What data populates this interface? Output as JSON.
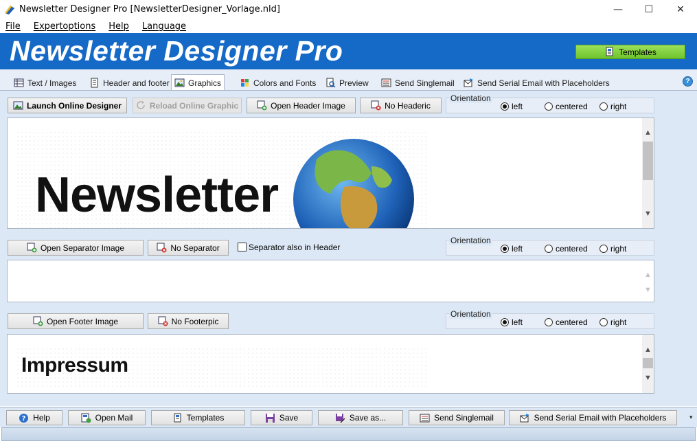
{
  "window": {
    "title": "Newsletter Designer Pro [NewsletterDesigner_Vorlage.nld]",
    "minimize_glyph": "—",
    "maximize_glyph": "☐",
    "close_glyph": "✕"
  },
  "menu": [
    "File",
    "Expertoptions",
    "Help",
    "Language"
  ],
  "banner": {
    "title": "Newsletter Designer Pro",
    "templates_button": "Templates",
    "accent_color": "#1569c7",
    "templates_color": "#7ecf3a"
  },
  "tabs": [
    {
      "label": "Text / Images",
      "icon": "table-icon",
      "active": false
    },
    {
      "label": "Header and footer",
      "icon": "document-icon",
      "active": false
    },
    {
      "label": "Graphics",
      "icon": "picture-icon",
      "active": true
    },
    {
      "label": "Colors and Fonts",
      "icon": "palette-icon",
      "active": false
    },
    {
      "label": "Preview",
      "icon": "magnifier-icon",
      "active": false
    },
    {
      "label": "Send Singlemail",
      "icon": "mail-list-icon",
      "active": false
    },
    {
      "label": "Send Serial Email with Placeholders",
      "icon": "mail-send-icon",
      "active": false
    }
  ],
  "help_glyph": "?",
  "header_section": {
    "launch_button": "Launch Online Designer",
    "reload_button": "Reload Online Graphic",
    "open_button": "Open Header Image",
    "none_button": "No Headeric",
    "orientation": {
      "legend": "Orientation",
      "options": [
        "left",
        "centered",
        "right"
      ],
      "selected": "left"
    },
    "image_text": "Newsletter"
  },
  "separator_section": {
    "open_button": "Open Separator Image",
    "none_button": "No Separator",
    "checkbox_label": "Separator also in Header",
    "checkbox_checked": false,
    "orientation": {
      "legend": "Orientation",
      "options": [
        "left",
        "centered",
        "right"
      ],
      "selected": "left"
    }
  },
  "footer_section": {
    "open_button": "Open Footer Image",
    "none_button": "No Footerpic",
    "orientation": {
      "legend": "Orientation",
      "options": [
        "left",
        "centered",
        "right"
      ],
      "selected": "left"
    },
    "image_text": "Impressum"
  },
  "bottom_toolbar": [
    {
      "label": "Help",
      "icon": "help-icon"
    },
    {
      "label": "Open Mail",
      "icon": "open-mail-icon"
    },
    {
      "label": "Templates",
      "icon": "templates-icon"
    },
    {
      "label": "Save",
      "icon": "save-icon"
    },
    {
      "label": "Save as...",
      "icon": "save-as-icon"
    },
    {
      "label": "Send Singlemail",
      "icon": "mail-list-icon"
    },
    {
      "label": "Send Serial Email with Placeholders",
      "icon": "mail-send-icon"
    }
  ]
}
